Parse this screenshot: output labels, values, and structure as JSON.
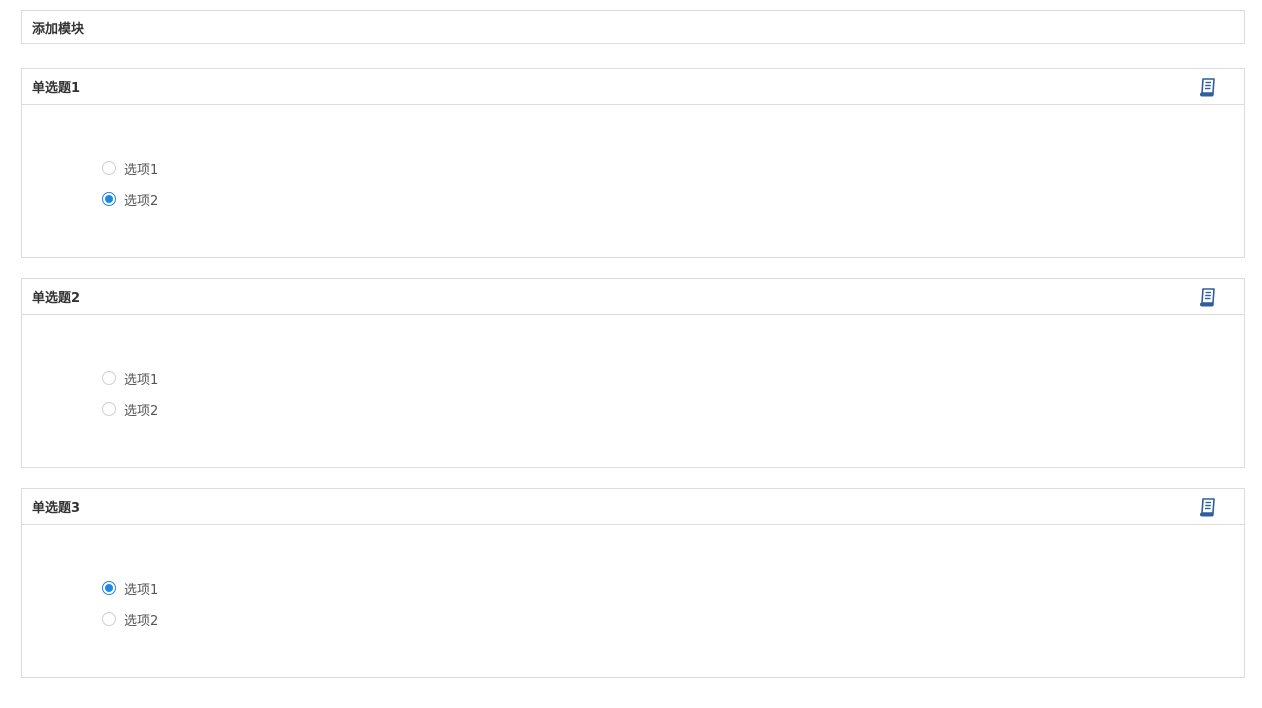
{
  "add_module": {
    "title": "添加模块"
  },
  "panels": [
    {
      "title": "单选题1",
      "options": [
        {
          "label": "选项1",
          "checked": false
        },
        {
          "label": "选项2",
          "checked": true
        }
      ]
    },
    {
      "title": "单选题2",
      "options": [
        {
          "label": "选项1",
          "checked": false
        },
        {
          "label": "选项2",
          "checked": false
        }
      ]
    },
    {
      "title": "单选题3",
      "options": [
        {
          "label": "选项1",
          "checked": true
        },
        {
          "label": "选项2",
          "checked": false
        }
      ]
    }
  ],
  "icons": {
    "panel_action": "edit-document-icon"
  },
  "colors": {
    "accent": "#1e88e5",
    "icon": "#2f5f9a",
    "border": "#dcdcdc"
  }
}
